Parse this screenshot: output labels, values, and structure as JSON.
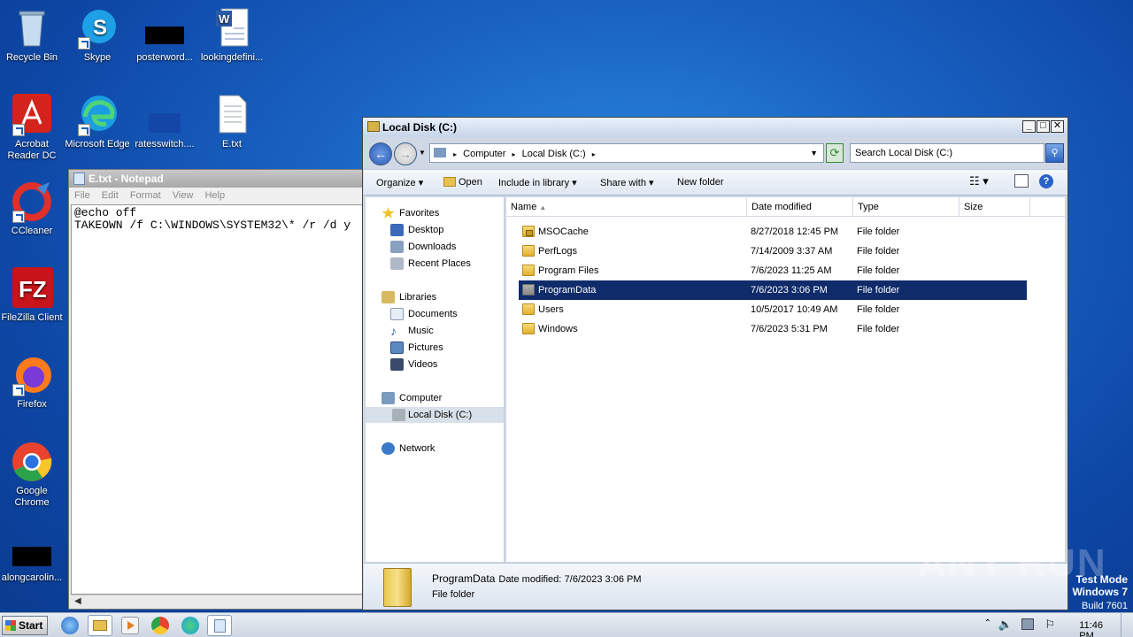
{
  "desktop": {
    "icons": [
      {
        "label": "Recycle Bin",
        "icon": "recycle-bin-icon"
      },
      {
        "label": "Skype",
        "icon": "skype-icon"
      },
      {
        "label": "posterword...",
        "icon": "blank-black-icon"
      },
      {
        "label": "lookingdefini...",
        "icon": "word-doc-icon"
      },
      {
        "label": "Acrobat Reader DC",
        "icon": "acrobat-icon"
      },
      {
        "label": "Microsoft Edge",
        "icon": "edge-icon"
      },
      {
        "label": "ratesswitch....",
        "icon": "blank-blue-icon"
      },
      {
        "label": "E.txt",
        "icon": "text-file-icon"
      },
      {
        "label": "CCleaner",
        "icon": "ccleaner-icon"
      },
      {
        "label": "FileZilla Client",
        "icon": "filezilla-icon"
      },
      {
        "label": "Firefox",
        "icon": "firefox-icon"
      },
      {
        "label": "Google Chrome",
        "icon": "chrome-icon"
      },
      {
        "label": "alongcarolin...",
        "icon": "blank-black-icon"
      }
    ]
  },
  "notepad": {
    "title": "E.txt - Notepad",
    "menu": [
      "File",
      "Edit",
      "Format",
      "View",
      "Help"
    ],
    "content": "@echo off\nTAKEOWN /f C:\\WINDOWS\\SYSTEM32\\* /r /d y"
  },
  "explorer": {
    "title": "Local Disk (C:)",
    "breadcrumb": [
      "Computer",
      "Local Disk (C:)"
    ],
    "search_placeholder": "Search Local Disk (C:)",
    "toolbar": {
      "organize": "Organize",
      "open": "Open",
      "include": "Include in library",
      "share": "Share with",
      "new_folder": "New folder"
    },
    "nav": {
      "favorites": "Favorites",
      "desktop": "Desktop",
      "downloads": "Downloads",
      "recent": "Recent Places",
      "libraries": "Libraries",
      "documents": "Documents",
      "music": "Music",
      "pictures": "Pictures",
      "videos": "Videos",
      "computer": "Computer",
      "localdisk": "Local Disk (C:)",
      "network": "Network"
    },
    "columns": {
      "name": "Name",
      "date": "Date modified",
      "type": "Type",
      "size": "Size"
    },
    "files": [
      {
        "name": "MSOCache",
        "date": "8/27/2018 12:45 PM",
        "type": "File folder"
      },
      {
        "name": "PerfLogs",
        "date": "7/14/2009 3:37 AM",
        "type": "File folder"
      },
      {
        "name": "Program Files",
        "date": "7/6/2023 11:25 AM",
        "type": "File folder"
      },
      {
        "name": "ProgramData",
        "date": "7/6/2023 3:06 PM",
        "type": "File folder"
      },
      {
        "name": "Users",
        "date": "10/5/2017 10:49 AM",
        "type": "File folder"
      },
      {
        "name": "Windows",
        "date": "7/6/2023 5:31 PM",
        "type": "File folder"
      }
    ],
    "details": {
      "name": "ProgramData",
      "date_label": "Date modified:",
      "date": "7/6/2023 3:06 PM",
      "type": "File folder"
    }
  },
  "watermark": {
    "brand": "ANY RUN",
    "mode": "Test Mode",
    "os": "Windows 7",
    "build": "Build 7601"
  },
  "taskbar": {
    "start": "Start",
    "time": "11:46 PM"
  }
}
